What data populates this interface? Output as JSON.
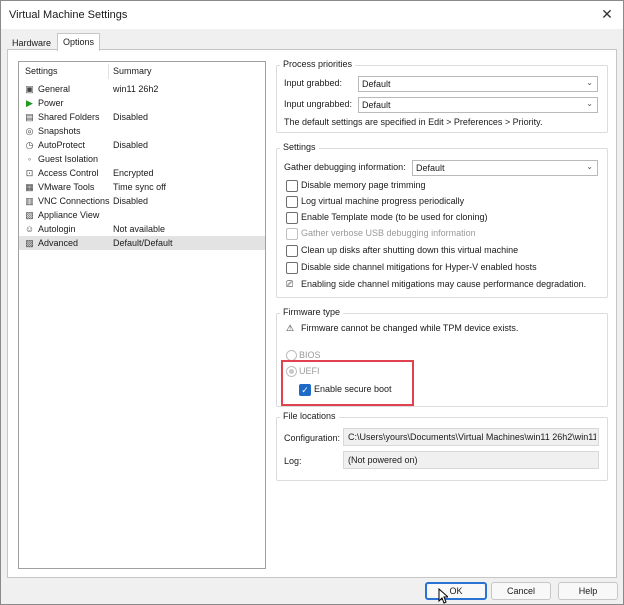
{
  "window": {
    "title": "Virtual Machine Settings"
  },
  "tabs": [
    {
      "label": "Hardware"
    },
    {
      "label": "Options"
    }
  ],
  "left_panel": {
    "headers": {
      "settings": "Settings",
      "summary": "Summary"
    },
    "rows": [
      {
        "name": "General",
        "summary": "win11 26h2",
        "icon": "general-icon"
      },
      {
        "name": "Power",
        "summary": "",
        "icon": "power-play-icon"
      },
      {
        "name": "Shared Folders",
        "summary": "Disabled",
        "icon": "folder-icon"
      },
      {
        "name": "Snapshots",
        "summary": "",
        "icon": "snapshot-icon"
      },
      {
        "name": "AutoProtect",
        "summary": "Disabled",
        "icon": "clock-icon"
      },
      {
        "name": "Guest Isolation",
        "summary": "",
        "icon": "isolation-icon"
      },
      {
        "name": "Access Control",
        "summary": "Encrypted",
        "icon": "lock-icon"
      },
      {
        "name": "VMware Tools",
        "summary": "Time sync off",
        "icon": "vm-icon"
      },
      {
        "name": "VNC Connections",
        "summary": "Disabled",
        "icon": "network-icon"
      },
      {
        "name": "Appliance View",
        "summary": "",
        "icon": "appliance-icon"
      },
      {
        "name": "Autologin",
        "summary": "Not available",
        "icon": "user-icon"
      },
      {
        "name": "Advanced",
        "summary": "Default/Default",
        "icon": "advanced-icon"
      }
    ]
  },
  "process_priorities": {
    "title": "Process priorities",
    "grabbed_label": "Input grabbed:",
    "grabbed_value": "Default",
    "ungrabbed_label": "Input ungrabbed:",
    "ungrabbed_value": "Default",
    "note": "The default settings are specified in Edit > Preferences > Priority."
  },
  "settings": {
    "title": "Settings",
    "debug_label": "Gather debugging information:",
    "debug_value": "Default",
    "checkboxes": [
      {
        "label": "Disable memory page trimming"
      },
      {
        "label": "Log virtual machine progress periodically"
      },
      {
        "label": "Enable Template mode (to be used for cloning)"
      },
      {
        "label": "Gather verbose USB debugging information"
      },
      {
        "label": "Clean up disks after shutting down this virtual machine"
      },
      {
        "label": "Disable side channel mitigations for Hyper-V enabled hosts"
      }
    ],
    "warning": "Enabling side channel mitigations may cause performance degradation."
  },
  "firmware": {
    "title": "Firmware type",
    "warning": "Firmware cannot be changed while TPM device exists.",
    "bios_label": "BIOS",
    "uefi_label": "UEFI",
    "secure_boot_label": "Enable secure boot"
  },
  "file_locations": {
    "title": "File locations",
    "config_label": "Configuration:",
    "config_value": "C:\\Users\\yours\\Documents\\Virtual Machines\\win11 26h2\\win11",
    "log_label": "Log:",
    "log_value": "(Not powered on)"
  },
  "buttons": {
    "ok": "OK",
    "cancel": "Cancel",
    "help": "Help"
  },
  "colors": {
    "accent": "#1e6ac7",
    "highlight": "#e0424f"
  }
}
